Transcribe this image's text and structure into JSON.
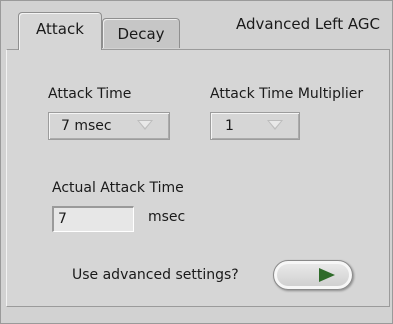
{
  "tabs": [
    {
      "label": "Attack",
      "selected": true
    },
    {
      "label": "Decay",
      "selected": false
    }
  ],
  "header_title": "Advanced Left AGC",
  "attack_time": {
    "label": "Attack Time",
    "value": "7 msec"
  },
  "attack_time_multiplier": {
    "label": "Attack Time Multiplier",
    "value": "1"
  },
  "actual_attack_time": {
    "label": "Actual Attack Time",
    "value": "7",
    "unit": "msec"
  },
  "advanced_settings": {
    "label": "Use advanced settings?",
    "state": "on",
    "led_color": "#2f6b2a"
  },
  "icons": {
    "ring_arrow": "down-triangle-icon",
    "toggle_indicator": "led-arrow-icon"
  }
}
